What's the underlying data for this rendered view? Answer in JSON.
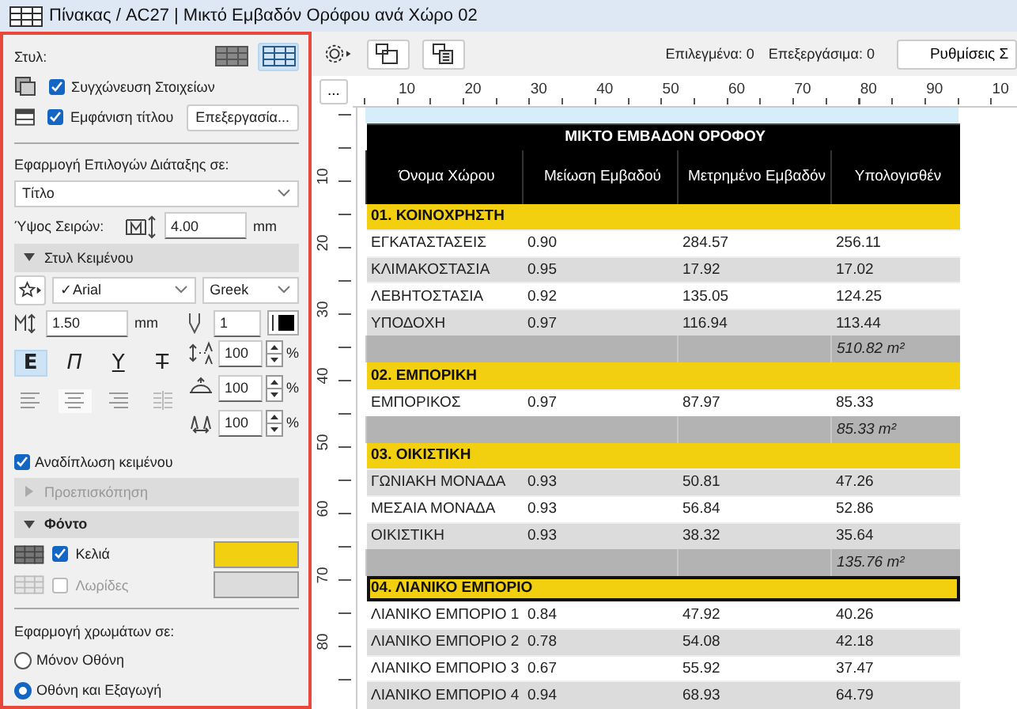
{
  "window": {
    "title": "Πίνακας / AC27 | Μικτό Εμβαδόν Ορόφου ανά Χώρο 02"
  },
  "format_panel": {
    "style_label": "Στυλ:",
    "style_options": [
      {
        "selected": false
      },
      {
        "selected": true
      }
    ],
    "merge_items": {
      "label": "Συγχώνευση Στοιχείων",
      "checked": true
    },
    "show_title": {
      "label": "Εμφάνιση τίτλου",
      "checked": true
    },
    "edit_button": "Επεξεργασία...",
    "apply_label": "Εφαρμογή Επιλογών Διάταξης σε:",
    "apply_target": "Τίτλο",
    "row_height": {
      "label": "Ύψος Σειρών:",
      "value": "4.00",
      "unit": "mm"
    },
    "text_style": {
      "title": "Στυλ Κειμένου",
      "expanded": true,
      "font": "✓Arial",
      "script": "Greek",
      "size": "1.50",
      "size_unit": "mm",
      "pen": "1",
      "styles": [
        {
          "label": "Ε",
          "selected": true
        },
        {
          "label": "Π",
          "selected": false
        },
        {
          "label": "Υ",
          "selected": false
        },
        {
          "label": "Τ",
          "selected": false
        }
      ],
      "alignments": [
        {
          "selected": false
        },
        {
          "selected": true
        },
        {
          "selected": false
        },
        {
          "selected": false
        }
      ],
      "spinners": [
        {
          "value": "100",
          "unit": "%"
        },
        {
          "value": "100",
          "unit": "%"
        },
        {
          "value": "100",
          "unit": "%"
        }
      ],
      "wrap_text": {
        "label": "Αναδίπλωση κειμένου",
        "checked": true
      }
    },
    "preview": {
      "title": "Προεπισκόπηση",
      "expanded": false,
      "disabled": true
    },
    "background": {
      "title": "Φόντο",
      "expanded": true,
      "items": [
        {
          "label": "Κελιά",
          "checked": true,
          "disabled": false,
          "color": "#f2cf0f"
        },
        {
          "label": "Λωρίδες",
          "checked": false,
          "disabled": true,
          "color": "#dcdcdc"
        }
      ]
    },
    "color_apply": {
      "label": "Εφαρμογή χρωμάτων σε:",
      "options": [
        {
          "label": "Μόνον Οθόνη",
          "selected": false
        },
        {
          "label": "Οθόνη και Εξαγωγή",
          "selected": true
        }
      ]
    }
  },
  "toolbar": {
    "selected_count": "Επιλεγμένα: 0",
    "editable_count": "Επεξεργάσιμα: 0",
    "settings_button": "Ρυθμίσεις Σ"
  },
  "ruler": {
    "more_button": "...",
    "marks": [
      "10",
      "20",
      "30",
      "40",
      "50",
      "60",
      "70",
      "80",
      "90",
      "10"
    ],
    "vertical_marks": [
      "10",
      "20",
      "30",
      "40",
      "50",
      "60",
      "70",
      "80"
    ]
  },
  "table": {
    "title": "ΜΙΚΤΟ ΕΜΒΑΔΟΝ ΟΡΟΦΟΥ",
    "columns": [
      "Όνομα Χώρου",
      "Μείωση Εμβαδού",
      "Μετρημένο Εμβαδόν",
      "Υπολογισθέν"
    ],
    "rows": [
      {
        "kind": "group",
        "label": "01. ΚΟΙΝΟΧΡΗΣΤΗ",
        "selected": false
      },
      {
        "kind": "data",
        "cells": [
          "ΕΓΚΑΤΑΣΤΑΣΕΙΣ",
          "0.90",
          "284.57",
          "256.11"
        ]
      },
      {
        "kind": "data",
        "cells": [
          "ΚΛΙΜΑΚΟΣΤΑΣΙΑ",
          "0.95",
          "17.92",
          "17.02"
        ]
      },
      {
        "kind": "data",
        "cells": [
          "ΛΕΒΗΤΟΣΤΑΣΙΑ",
          "0.92",
          "135.05",
          "124.25"
        ]
      },
      {
        "kind": "data",
        "cells": [
          "ΥΠΟΔΟΧΗ",
          "0.97",
          "116.94",
          "113.44"
        ]
      },
      {
        "kind": "total",
        "value": "510.82 m²"
      },
      {
        "kind": "group",
        "label": "02. ΕΜΠΟΡΙΚΗ",
        "selected": false
      },
      {
        "kind": "data",
        "cells": [
          "ΕΜΠΟΡΙΚΟΣ",
          "0.97",
          "87.97",
          "85.33"
        ]
      },
      {
        "kind": "total",
        "value": "85.33 m²"
      },
      {
        "kind": "group",
        "label": "03. ΟΙΚΙΣΤΙΚΗ",
        "selected": false
      },
      {
        "kind": "data",
        "cells": [
          "ΓΩΝΙΑΚΗ ΜΟΝΑΔΑ",
          "0.93",
          "50.81",
          "47.26"
        ]
      },
      {
        "kind": "data",
        "cells": [
          "ΜΕΣΑΙΑ ΜΟΝΑΔΑ",
          "0.93",
          "56.84",
          "52.86"
        ]
      },
      {
        "kind": "data",
        "cells": [
          "ΟΙΚΙΣΤΙΚΗ",
          "0.93",
          "38.32",
          "35.64"
        ]
      },
      {
        "kind": "total",
        "value": "135.76 m²"
      },
      {
        "kind": "group",
        "label": "04. ΛΙΑΝΙΚΟ ΕΜΠΟΡΙΟ",
        "selected": true
      },
      {
        "kind": "data",
        "cells": [
          "ΛΙΑΝΙΚΟ ΕΜΠΟΡΙΟ 1",
          "0.84",
          "47.92",
          "40.26"
        ]
      },
      {
        "kind": "data",
        "cells": [
          "ΛΙΑΝΙΚΟ ΕΜΠΟΡΙΟ 2",
          "0.78",
          "54.08",
          "42.18"
        ]
      },
      {
        "kind": "data",
        "cells": [
          "ΛΙΑΝΙΚΟ ΕΜΠΟΡΙΟ 3",
          "0.67",
          "55.92",
          "37.47"
        ]
      },
      {
        "kind": "data",
        "cells": [
          "ΛΙΑΝΙΚΟ ΕΜΠΟΡΙΟ 4",
          "0.94",
          "68.93",
          "64.79"
        ]
      }
    ]
  }
}
